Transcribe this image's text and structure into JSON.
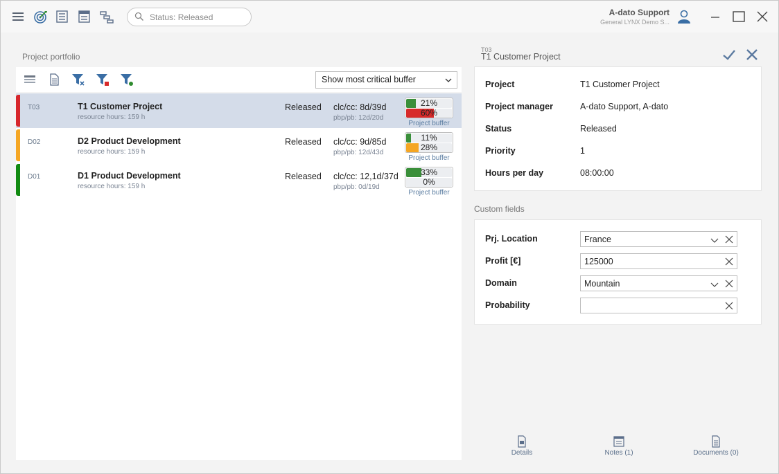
{
  "search": {
    "placeholder": "Status: Released"
  },
  "user": {
    "name": "A-dato Support",
    "org": "General LYNX Demo S..."
  },
  "left_panel": {
    "title": "Project portfolio",
    "buffer_select": "Show most critical buffer",
    "projects": [
      {
        "code": "T03",
        "name": "T1 Customer Project",
        "resource_hours": "resource hours: 159 h",
        "status": "Released",
        "clc": "clc/cc: 8d/39d",
        "pbp": "pbp/pb: 12d/20d",
        "bar1_pct": "21%",
        "bar1_value": 0.21,
        "bar1_color": "#3a8f3a",
        "bar2_pct": "60%",
        "bar2_value": 0.6,
        "bar2_color": "#d72a2a",
        "stripe_color": "#d7262b",
        "buffer_label": "Project buffer"
      },
      {
        "code": "D02",
        "name": "D2  Product Development",
        "resource_hours": "resource hours: 159 h",
        "status": "Released",
        "clc": "clc/cc: 9d/85d",
        "pbp": "pbp/pb: 12d/43d",
        "bar1_pct": "11%",
        "bar1_value": 0.11,
        "bar1_color": "#3a8f3a",
        "bar2_pct": "28%",
        "bar2_value": 0.28,
        "bar2_color": "#f5a623",
        "stripe_color": "#f5a623",
        "buffer_label": "Project buffer"
      },
      {
        "code": "D01",
        "name": "D1 Product Development",
        "resource_hours": "resource hours: 159 h",
        "status": "Released",
        "clc": "clc/cc: 12,1d/37d",
        "pbp": "pbp/pb: 0d/19d",
        "bar1_pct": "33%",
        "bar1_value": 0.33,
        "bar1_color": "#3a8f3a",
        "bar2_pct": "0%",
        "bar2_value": 0.0,
        "bar2_color": "#3a8f3a",
        "stripe_color": "#118a11",
        "buffer_label": "Project buffer"
      }
    ]
  },
  "detail": {
    "code": "T03",
    "title": "T1 Customer Project",
    "properties": [
      {
        "label": "Project",
        "value": "T1 Customer Project"
      },
      {
        "label": "Project manager",
        "value": "A-dato Support, A-dato"
      },
      {
        "label": "Status",
        "value": "Released"
      },
      {
        "label": "Priority",
        "value": "1"
      },
      {
        "label": "Hours per day",
        "value": "08:00:00"
      }
    ],
    "custom_fields_title": "Custom fields",
    "custom_fields": [
      {
        "label": "Prj. Location",
        "value": "France",
        "dropdown": true
      },
      {
        "label": "Profit [€]",
        "value": "125000",
        "dropdown": false
      },
      {
        "label": "Domain",
        "value": "Mountain",
        "dropdown": true
      },
      {
        "label": "Probability",
        "value": "",
        "dropdown": false
      }
    ]
  },
  "bottom_tabs": [
    {
      "label": "Details"
    },
    {
      "label": "Notes (1)"
    },
    {
      "label": "Documents (0)"
    }
  ],
  "colors": {
    "accent": "#3a6ea5",
    "icon": "#5b6e8a",
    "selected_row": "#d4dce9"
  }
}
